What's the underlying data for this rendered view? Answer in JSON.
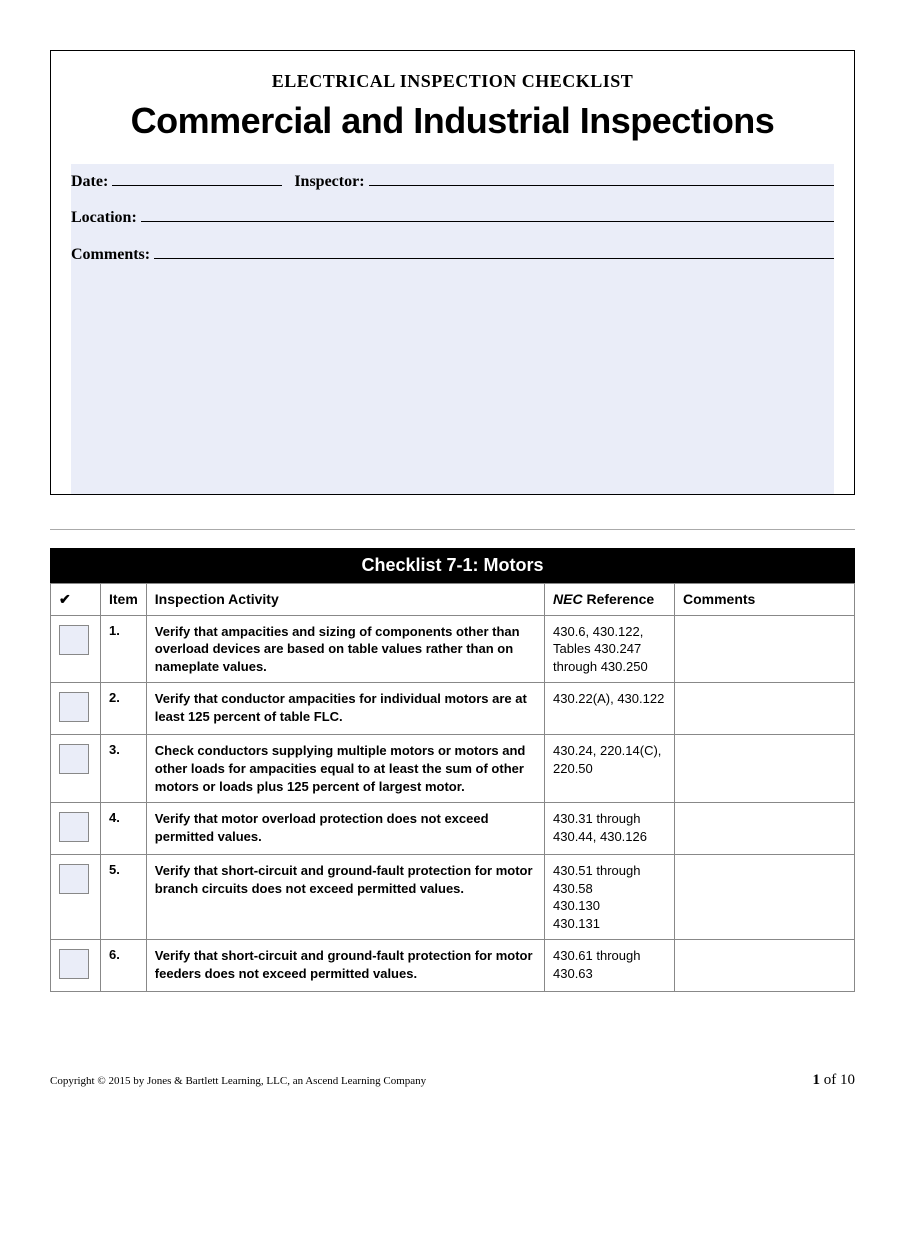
{
  "header": {
    "overline": "ELECTRICAL INSPECTION CHECKLIST",
    "title": "Commercial and Industrial Inspections",
    "fields": {
      "date_label": "Date:",
      "inspector_label": "Inspector:",
      "location_label": "Location:",
      "comments_label": "Comments:"
    }
  },
  "checklist": {
    "title": "Checklist 7-1: Motors",
    "columns": {
      "check": "✔",
      "item": "Item",
      "activity": "Inspection Activity",
      "nec_prefix": "NEC",
      "nec_suffix": " Reference",
      "comments": "Comments"
    },
    "rows": [
      {
        "item": "1.",
        "activity": "Verify that ampacities and sizing of components other than overload devices are based on table values rather than on nameplate values.",
        "nec": "430.6, 430.122, Tables 430.247 through 430.250",
        "comments": ""
      },
      {
        "item": "2.",
        "activity": "Verify that conductor ampacities for individual motors are at least 125 percent of table FLC.",
        "nec": "430.22(A), 430.122",
        "comments": ""
      },
      {
        "item": "3.",
        "activity": "Check conductors supplying multiple motors or motors and other loads for ampacities equal to at least the sum of other motors or loads plus 125 percent of largest motor.",
        "nec": "430.24, 220.14(C), 220.50",
        "comments": ""
      },
      {
        "item": "4.",
        "activity": "Verify that motor overload protection does not exceed permitted values.",
        "nec": "430.31 through 430.44, 430.126",
        "comments": ""
      },
      {
        "item": "5.",
        "activity": "Verify that short-circuit and ground-fault protection for motor branch circuits does not exceed permitted values.",
        "nec": "430.51 through 430.58\n430.130\n430.131",
        "comments": ""
      },
      {
        "item": "6.",
        "activity": "Verify that short-circuit and ground-fault protection for motor feeders does not exceed permitted values.",
        "nec": "430.61 through 430.63",
        "comments": ""
      }
    ]
  },
  "footer": {
    "copyright": "Copyright © 2015 by Jones & Bartlett Learning, LLC, an Ascend Learning Company",
    "page_current": "1",
    "page_sep": " of ",
    "page_total": "10"
  }
}
